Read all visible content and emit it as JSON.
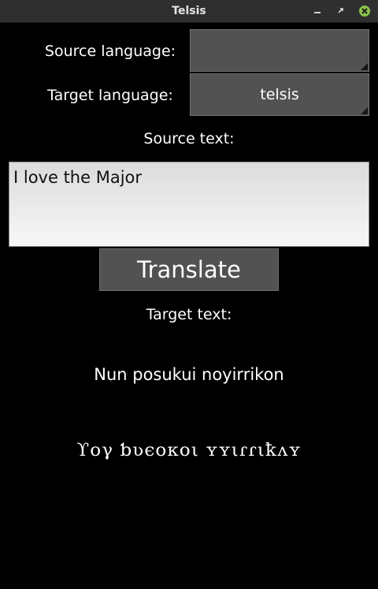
{
  "window": {
    "title": "Telsis"
  },
  "form": {
    "source_language_label": "Source language:",
    "source_language_value": "",
    "target_language_label": "Target language:",
    "target_language_value": "telsis",
    "source_text_label": "Source text:",
    "source_text_value": "I love the Major",
    "translate_label": "Translate",
    "target_text_label": "Target text:"
  },
  "output": {
    "translation": "Nun posukui noyirrikon",
    "script_rendering": "ϒογ ƅʋєoκoι ʏʏιɾɾιꝁʌʏ"
  },
  "icons": {
    "minimize": "minimize-icon",
    "maximize": "maximize-icon",
    "close": "close-icon"
  },
  "colors": {
    "background": "#000000",
    "button": "#525252",
    "close_button": "#8bc34a"
  }
}
